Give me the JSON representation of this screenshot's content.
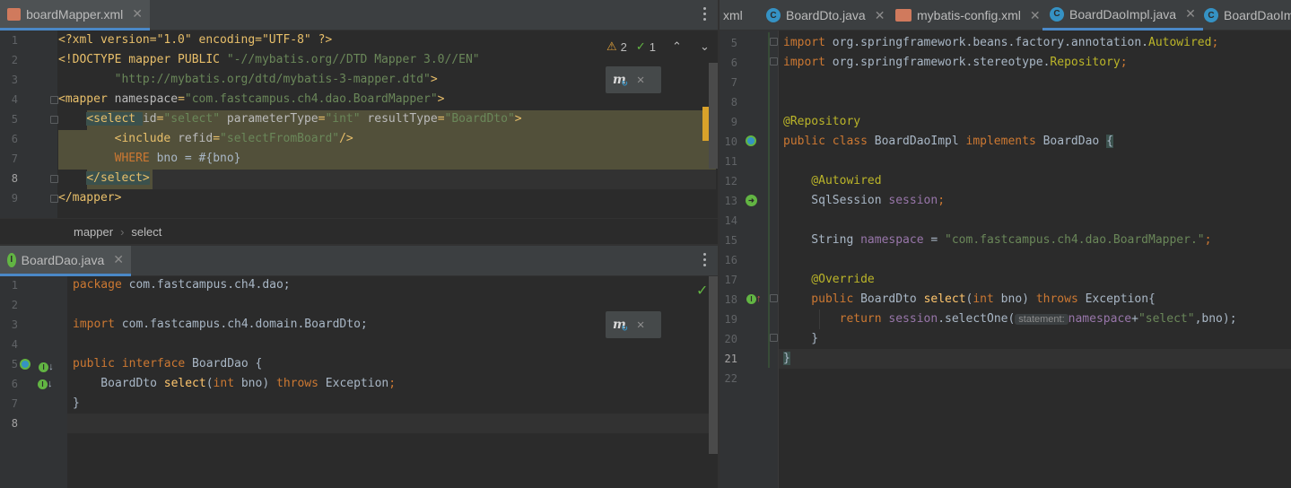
{
  "left_top": {
    "tab": {
      "label": "boardMapper.xml",
      "icon": "xml-file-icon"
    },
    "inspections": {
      "warnings": "2",
      "ok": "1"
    },
    "lines": [
      {
        "n": "1"
      },
      {
        "n": "2"
      },
      {
        "n": "3"
      },
      {
        "n": "4"
      },
      {
        "n": "5"
      },
      {
        "n": "6"
      },
      {
        "n": "7"
      },
      {
        "n": "8"
      },
      {
        "n": "9"
      }
    ],
    "code": {
      "l1": "<?xml version=\"1.0\" encoding=\"UTF-8\" ?>",
      "l2a": "<!DOCTYPE mapper PUBLIC ",
      "l2b": "\"-//mybatis.org//DTD Mapper 3.0//EN\"",
      "l3a": "        ",
      "l3b": "\"http://mybatis.org/dtd/mybatis-3-mapper.dtd\"",
      "l3c": ">",
      "l4a": "<mapper ",
      "l4b": "namespace",
      "l4c": "=",
      "l4d": "\"com.fastcampus.ch4.dao.BoardMapper\"",
      "l4e": ">",
      "l5a": "    ",
      "l5b": "<select ",
      "l5c": "id",
      "l5d": "=",
      "l5e": "\"select\"",
      "l5f": " parameterType",
      "l5g": "=",
      "l5h": "\"int\"",
      "l5i": " resultType",
      "l5j": "=",
      "l5k": "\"BoardDto\"",
      "l5l": ">",
      "l6a": "        ",
      "l6b": "<include ",
      "l6c": "refid",
      "l6d": "=",
      "l6e": "\"selectFromBoard\"",
      "l6f": "/>",
      "l7a": "        ",
      "l7b": "WHERE",
      "l7c": " bno = #{bno}",
      "l8a": "    ",
      "l8b": "</select>",
      "l9": "</mapper>"
    },
    "breadcrumb": {
      "item1": "mapper",
      "sep": "›",
      "item2": "select"
    }
  },
  "left_bottom": {
    "tab": {
      "label": "BoardDao.java",
      "icon": "interface-icon"
    },
    "lines": [
      {
        "n": "1"
      },
      {
        "n": "2"
      },
      {
        "n": "3"
      },
      {
        "n": "4"
      },
      {
        "n": "5"
      },
      {
        "n": "6"
      },
      {
        "n": "7"
      },
      {
        "n": "8"
      }
    ],
    "code": {
      "l1a": "package",
      "l1b": " com.fastcampus.ch4.dao;",
      "l3a": "import",
      "l3b": " com.fastcampus.ch4.domain.BoardDto;",
      "l5a": "public interface",
      "l5b": " BoardDao {",
      "l6a": "    BoardDto ",
      "l6b": "select",
      "l6c": "(",
      "l6d": "int",
      "l6e": " bno) ",
      "l6f": "throws",
      "l6g": " Exception",
      "l6h": ";",
      "l7": "}"
    }
  },
  "right": {
    "tabs": [
      {
        "label": "xml"
      },
      {
        "label": "BoardDto.java"
      },
      {
        "label": "mybatis-config.xml"
      },
      {
        "label": "BoardDaoImpl.java"
      },
      {
        "label": "BoardDaoIm"
      }
    ],
    "lines": [
      {
        "n": "5"
      },
      {
        "n": "6"
      },
      {
        "n": "7"
      },
      {
        "n": "8"
      },
      {
        "n": "9"
      },
      {
        "n": "10"
      },
      {
        "n": "11"
      },
      {
        "n": "12"
      },
      {
        "n": "13"
      },
      {
        "n": "14"
      },
      {
        "n": "15"
      },
      {
        "n": "16"
      },
      {
        "n": "17"
      },
      {
        "n": "18"
      },
      {
        "n": "19"
      },
      {
        "n": "20"
      },
      {
        "n": "21"
      },
      {
        "n": "22"
      }
    ],
    "code": {
      "l5a": "import",
      "l5b": " org.springframework.beans.factory.annotation.",
      "l5c": "Autowired",
      "l5d": ";",
      "l6a": "import",
      "l6b": " org.springframework.stereotype.",
      "l6c": "Repository",
      "l6d": ";",
      "l9": "@Repository",
      "l10a": "public class",
      "l10b": " BoardDaoImpl ",
      "l10c": "implements",
      "l10d": " BoardDao ",
      "l10e": "{",
      "l12": "    @Autowired",
      "l13a": "    SqlSession ",
      "l13b": "session",
      "l13c": ";",
      "l15a": "    String ",
      "l15b": "namespace",
      "l15c": " = ",
      "l15d": "\"com.fastcampus.ch4.dao.BoardMapper.\"",
      "l15e": ";",
      "l17": "    @Override",
      "l18a": "    public",
      "l18b": " BoardDto ",
      "l18c": "select",
      "l18d": "(",
      "l18e": "int",
      "l18f": " bno) ",
      "l18g": "throws",
      "l18h": " Exception{",
      "l19a": "        return",
      "l19b": " ",
      "l19c": "session",
      "l19d": ".selectOne(",
      "l19hint": "statement:",
      "l19e": "namespace",
      "l19f": "+",
      "l19g": "\"select\"",
      "l19h": ",bno);",
      "l20": "    }",
      "l21": "}"
    }
  }
}
